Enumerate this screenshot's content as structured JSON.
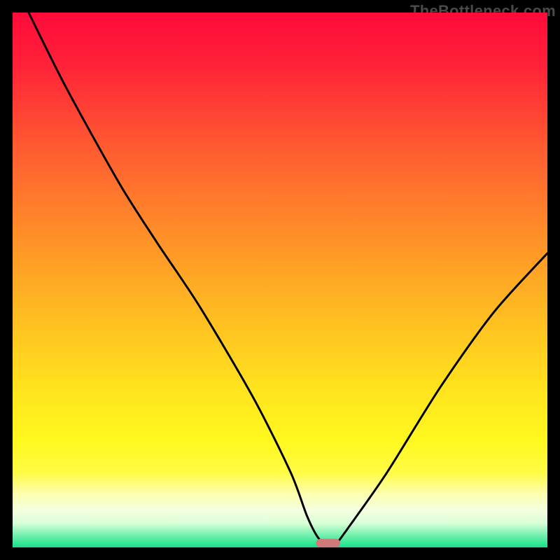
{
  "watermark": "TheBottleneck.com",
  "chart_data": {
    "type": "line",
    "title": "",
    "xlabel": "",
    "ylabel": "",
    "xlim": [
      0,
      100
    ],
    "ylim": [
      0,
      100
    ],
    "grid": false,
    "legend": false,
    "series": [
      {
        "name": "bottleneck-curve",
        "x": [
          3,
          10,
          20,
          27,
          35,
          45,
          52,
          55,
          57,
          59,
          60,
          63,
          70,
          80,
          90,
          100
        ],
        "y": [
          100,
          86,
          68,
          57,
          45,
          28,
          14,
          6,
          2,
          0,
          0,
          4,
          14,
          30,
          44,
          55
        ]
      }
    ],
    "marker": {
      "name": "optimum-marker",
      "x": 59,
      "y": 0,
      "width": 4.5,
      "height": 1.6,
      "color": "#cf7a78"
    },
    "gradient_stops": [
      {
        "offset": 0.0,
        "color": "#ff0a3a"
      },
      {
        "offset": 0.1,
        "color": "#ff2338"
      },
      {
        "offset": 0.25,
        "color": "#ff5a31"
      },
      {
        "offset": 0.4,
        "color": "#ff8a2a"
      },
      {
        "offset": 0.55,
        "color": "#ffb822"
      },
      {
        "offset": 0.7,
        "color": "#ffe21e"
      },
      {
        "offset": 0.8,
        "color": "#fff81f"
      },
      {
        "offset": 0.86,
        "color": "#fffc45"
      },
      {
        "offset": 0.9,
        "color": "#fdffb0"
      },
      {
        "offset": 0.93,
        "color": "#f6ffe0"
      },
      {
        "offset": 0.955,
        "color": "#d8ffd8"
      },
      {
        "offset": 0.975,
        "color": "#7bf2b0"
      },
      {
        "offset": 1.0,
        "color": "#18e08a"
      }
    ]
  }
}
